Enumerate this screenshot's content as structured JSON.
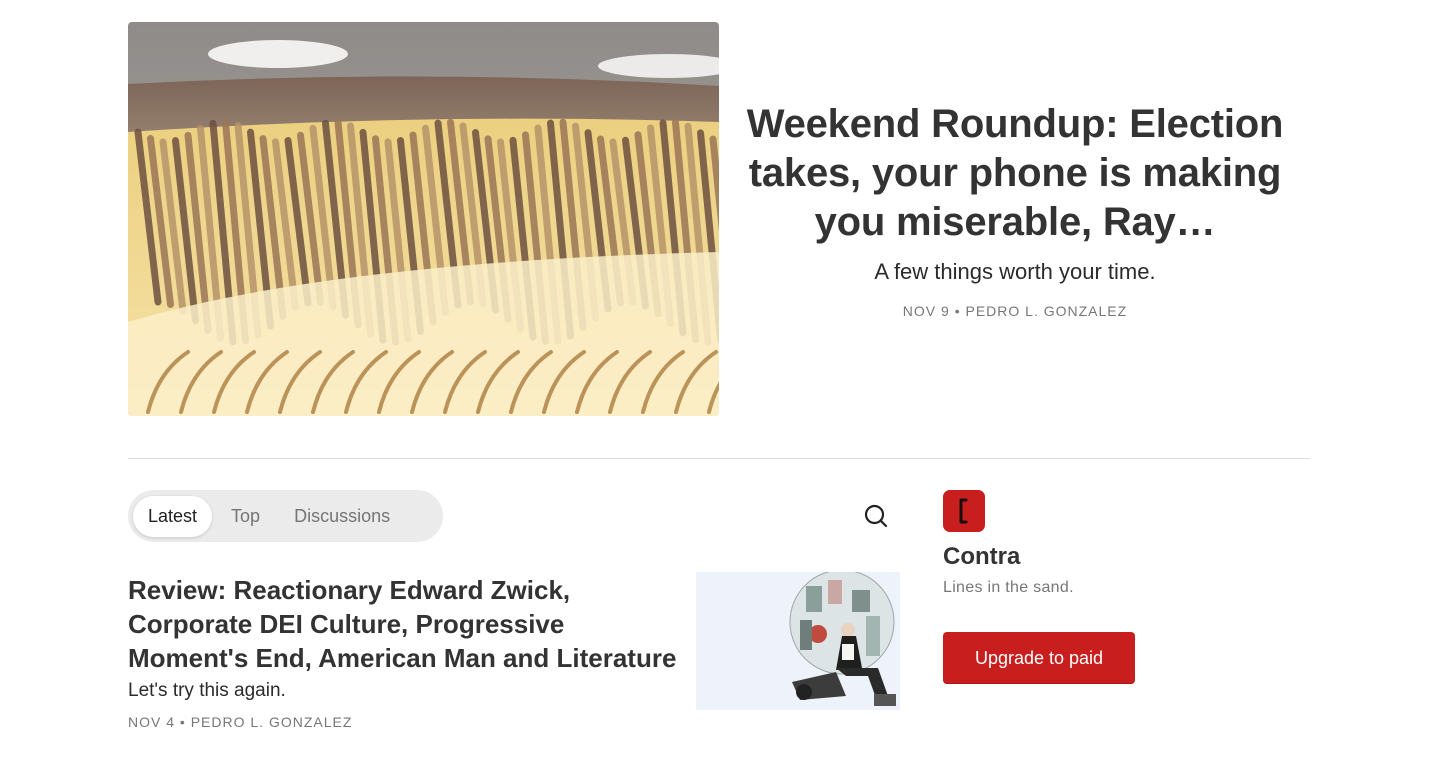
{
  "hero": {
    "title": "Weekend Roundup: Election takes, your phone is making you miserable, Ray…",
    "subtitle": "A few things worth your time.",
    "date": "NOV 9",
    "separator": "•",
    "author": "PEDRO L. GONZALEZ"
  },
  "tabs": [
    {
      "label": "Latest",
      "active": true
    },
    {
      "label": "Top",
      "active": false
    },
    {
      "label": "Discussions",
      "active": false
    }
  ],
  "post": {
    "title": "Review: Reactionary Edward Zwick, Corporate DEI Culture, Progressive Moment's End, American Man and Literature",
    "subtitle": "Let's try this again.",
    "date": "NOV 4",
    "separator": "•",
    "author": "PEDRO L. GONZALEZ"
  },
  "publication": {
    "name": "Contra",
    "tagline": "Lines in the sand.",
    "upgrade_label": "Upgrade to paid",
    "logo_glyph": "[",
    "brand_color": "#c81e1e"
  },
  "icons": {
    "search": "search-icon"
  }
}
